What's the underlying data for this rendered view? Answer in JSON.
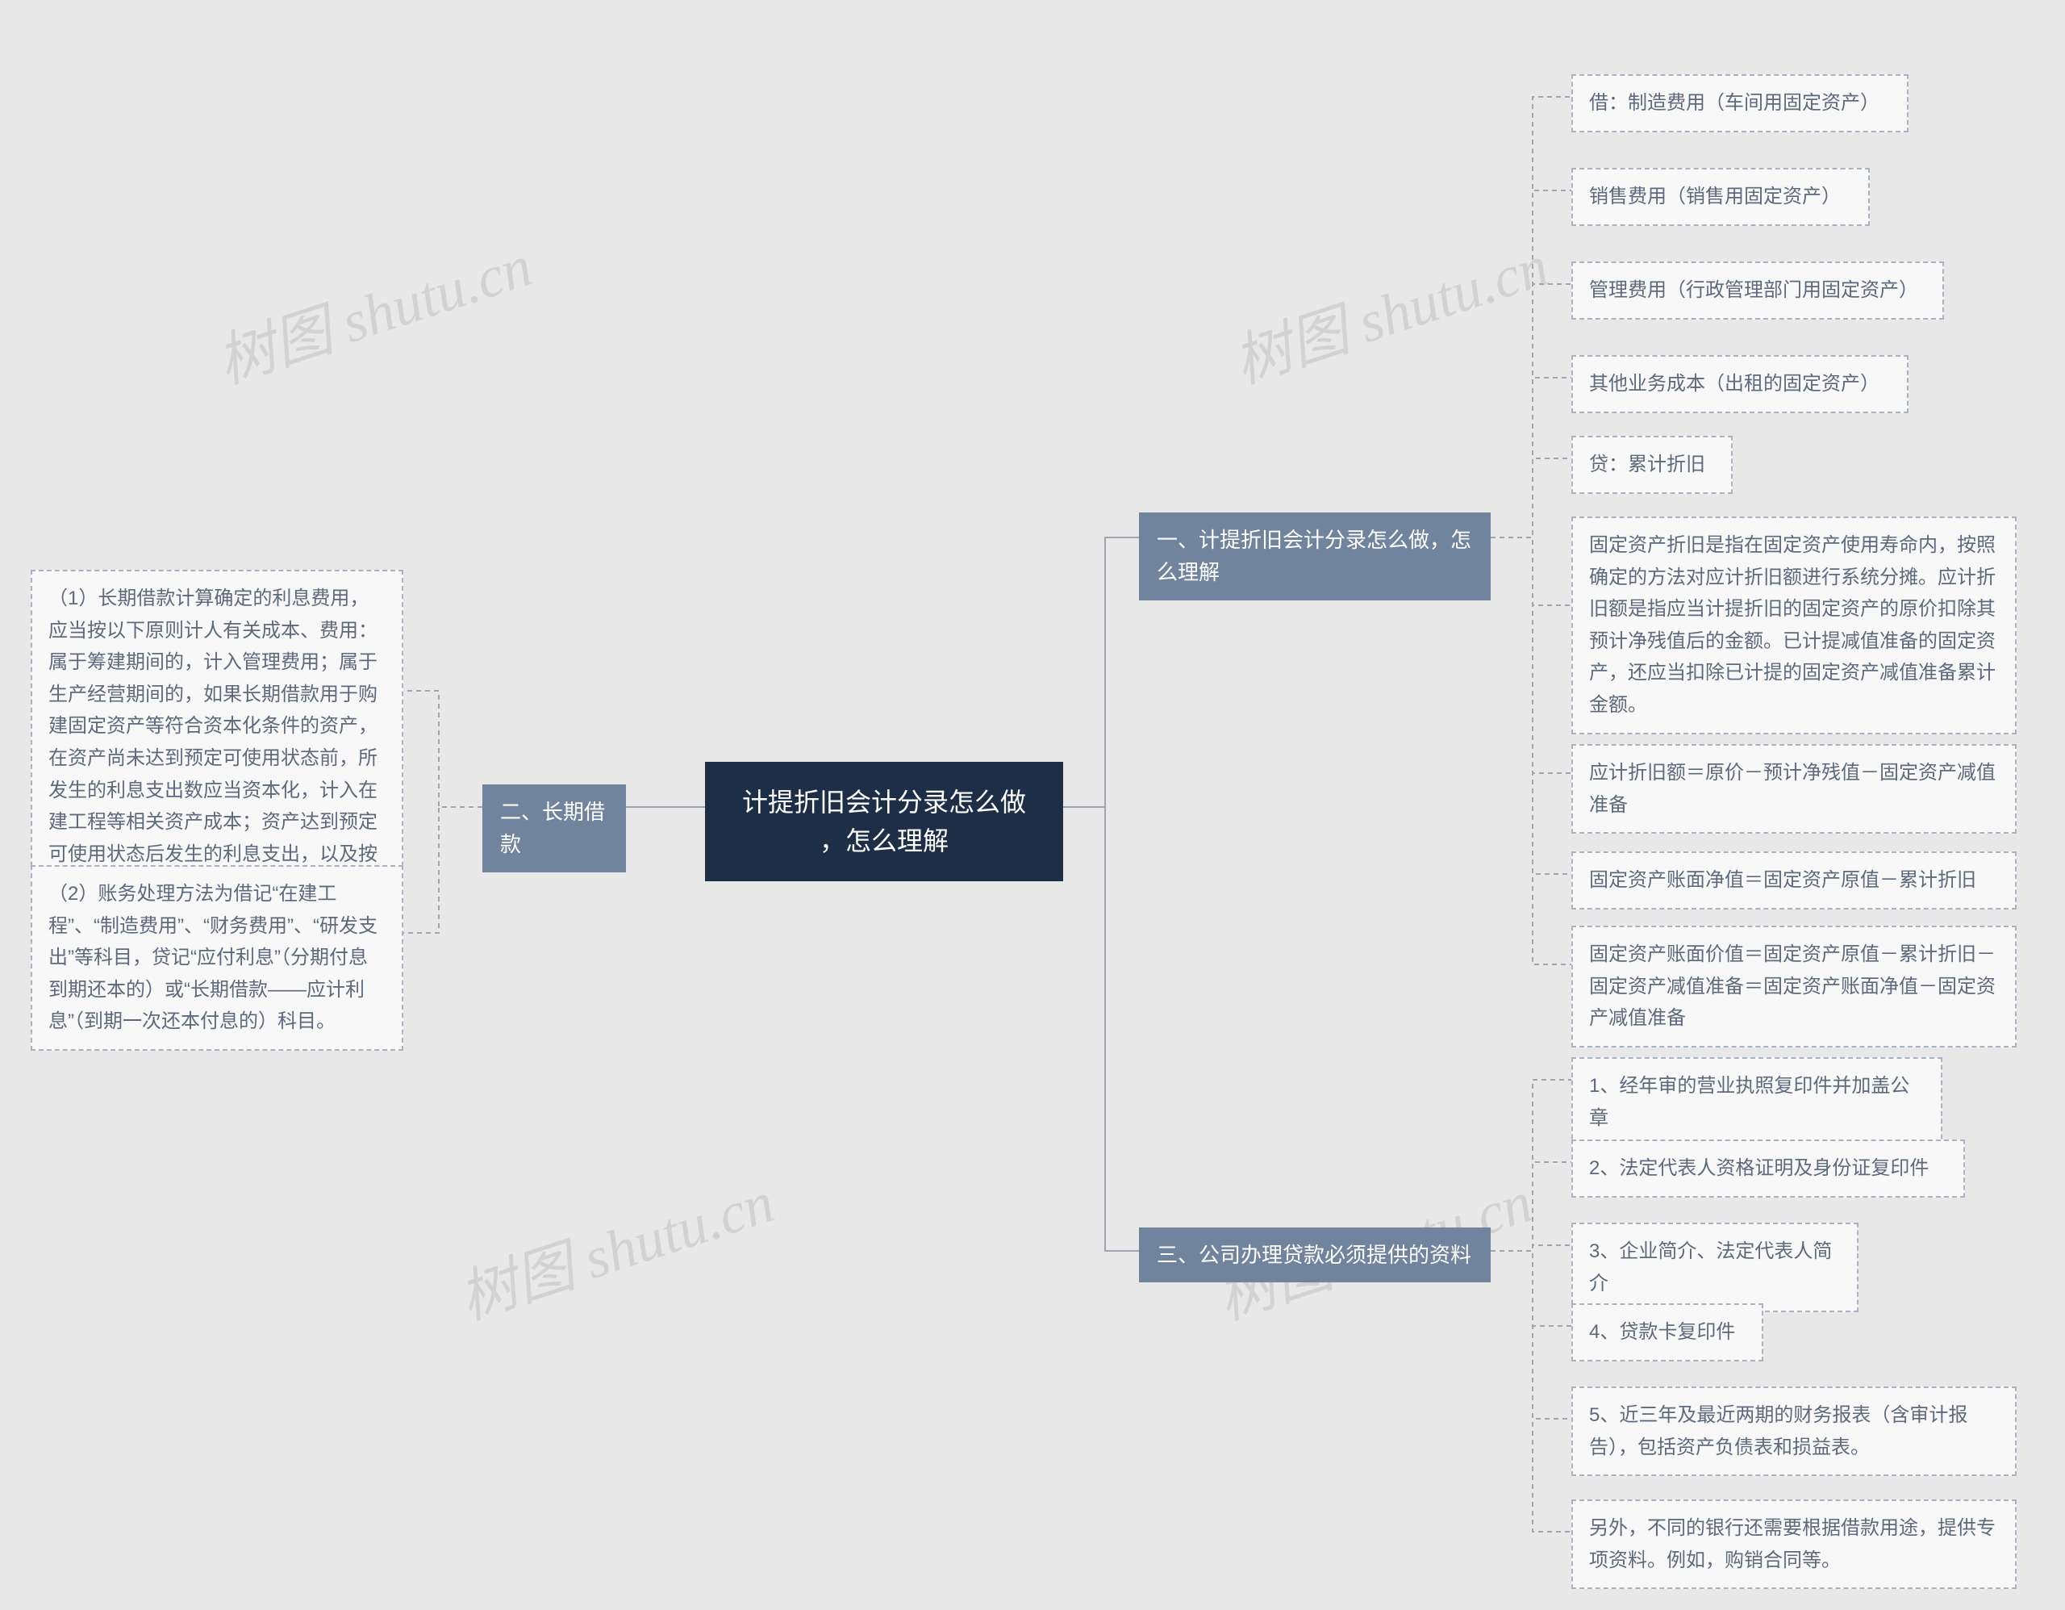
{
  "root": {
    "title": "计提折旧会计分录怎么做\n，怎么理解"
  },
  "branch1": {
    "label": "一、计提折旧会计分录怎么做，怎\n么理解",
    "leaves": [
      "借：制造费用（车间用固定资产）",
      "销售费用（销售用固定资产）",
      "管理费用（行政管理部门用固定资产）",
      "其他业务成本（出租的固定资产）",
      "贷：累计折旧",
      "固定资产折旧是指在固定资产使用寿命内，按照确定的方法对应计折旧额进行系统分摊。应计折旧额是指应当计提折旧的固定资产的原价扣除其预计净残值后的金额。已计提减值准备的固定资产，还应当扣除已计提的固定资产减值准备累计金额。",
      "应计折旧额＝原价－预计净残值－固定资产减值准备",
      "固定资产账面净值＝固定资产原值－累计折旧",
      "固定资产账面价值＝固定资产原值－累计折旧－固定资产减值准备＝固定资产账面净值－固定资产减值准备"
    ]
  },
  "branch2": {
    "label": "二、长期借款",
    "leaves": [
      "（1）长期借款计算确定的利息费用，应当按以下原则计人有关成本、费用：属于筹建期间的，计入管理费用；属于生产经营期间的，如果长期借款用于购建固定资产等符合资本化条件的资产，在资产尚未达到预定可使用状态前，所发生的利息支出数应当资本化，计入在建工程等相关资产成本；资产达到预定可使用状态后发生的利息支出，以及按规定不予资本化的利息支出，计入财务费用。",
      "（2）账务处理方法为借记“在建工程”、“制造费用”、“财务费用”、“研发支出”等科目，贷记“应付利息”（分期付息到期还本的）或“长期借款——应计利息”（到期一次还本付息的）科目。"
    ]
  },
  "branch3": {
    "label": "三、公司办理贷款必须提供的资料",
    "leaves": [
      "1、经年审的营业执照复印件并加盖公章",
      "2、法定代表人资格证明及身份证复印件",
      "3、企业简介、法定代表人简介",
      "4、贷款卡复印件",
      "5、近三年及最近两期的财务报表（含审计报告），包括资产负债表和损益表。",
      "另外，不同的银行还需要根据借款用途，提供专项资料。例如，购销合同等。"
    ]
  },
  "watermarks": [
    "树图 shutu.cn",
    "树图 shutu.cn",
    "树图 shutu.cn",
    "树图 shutu.cn"
  ]
}
